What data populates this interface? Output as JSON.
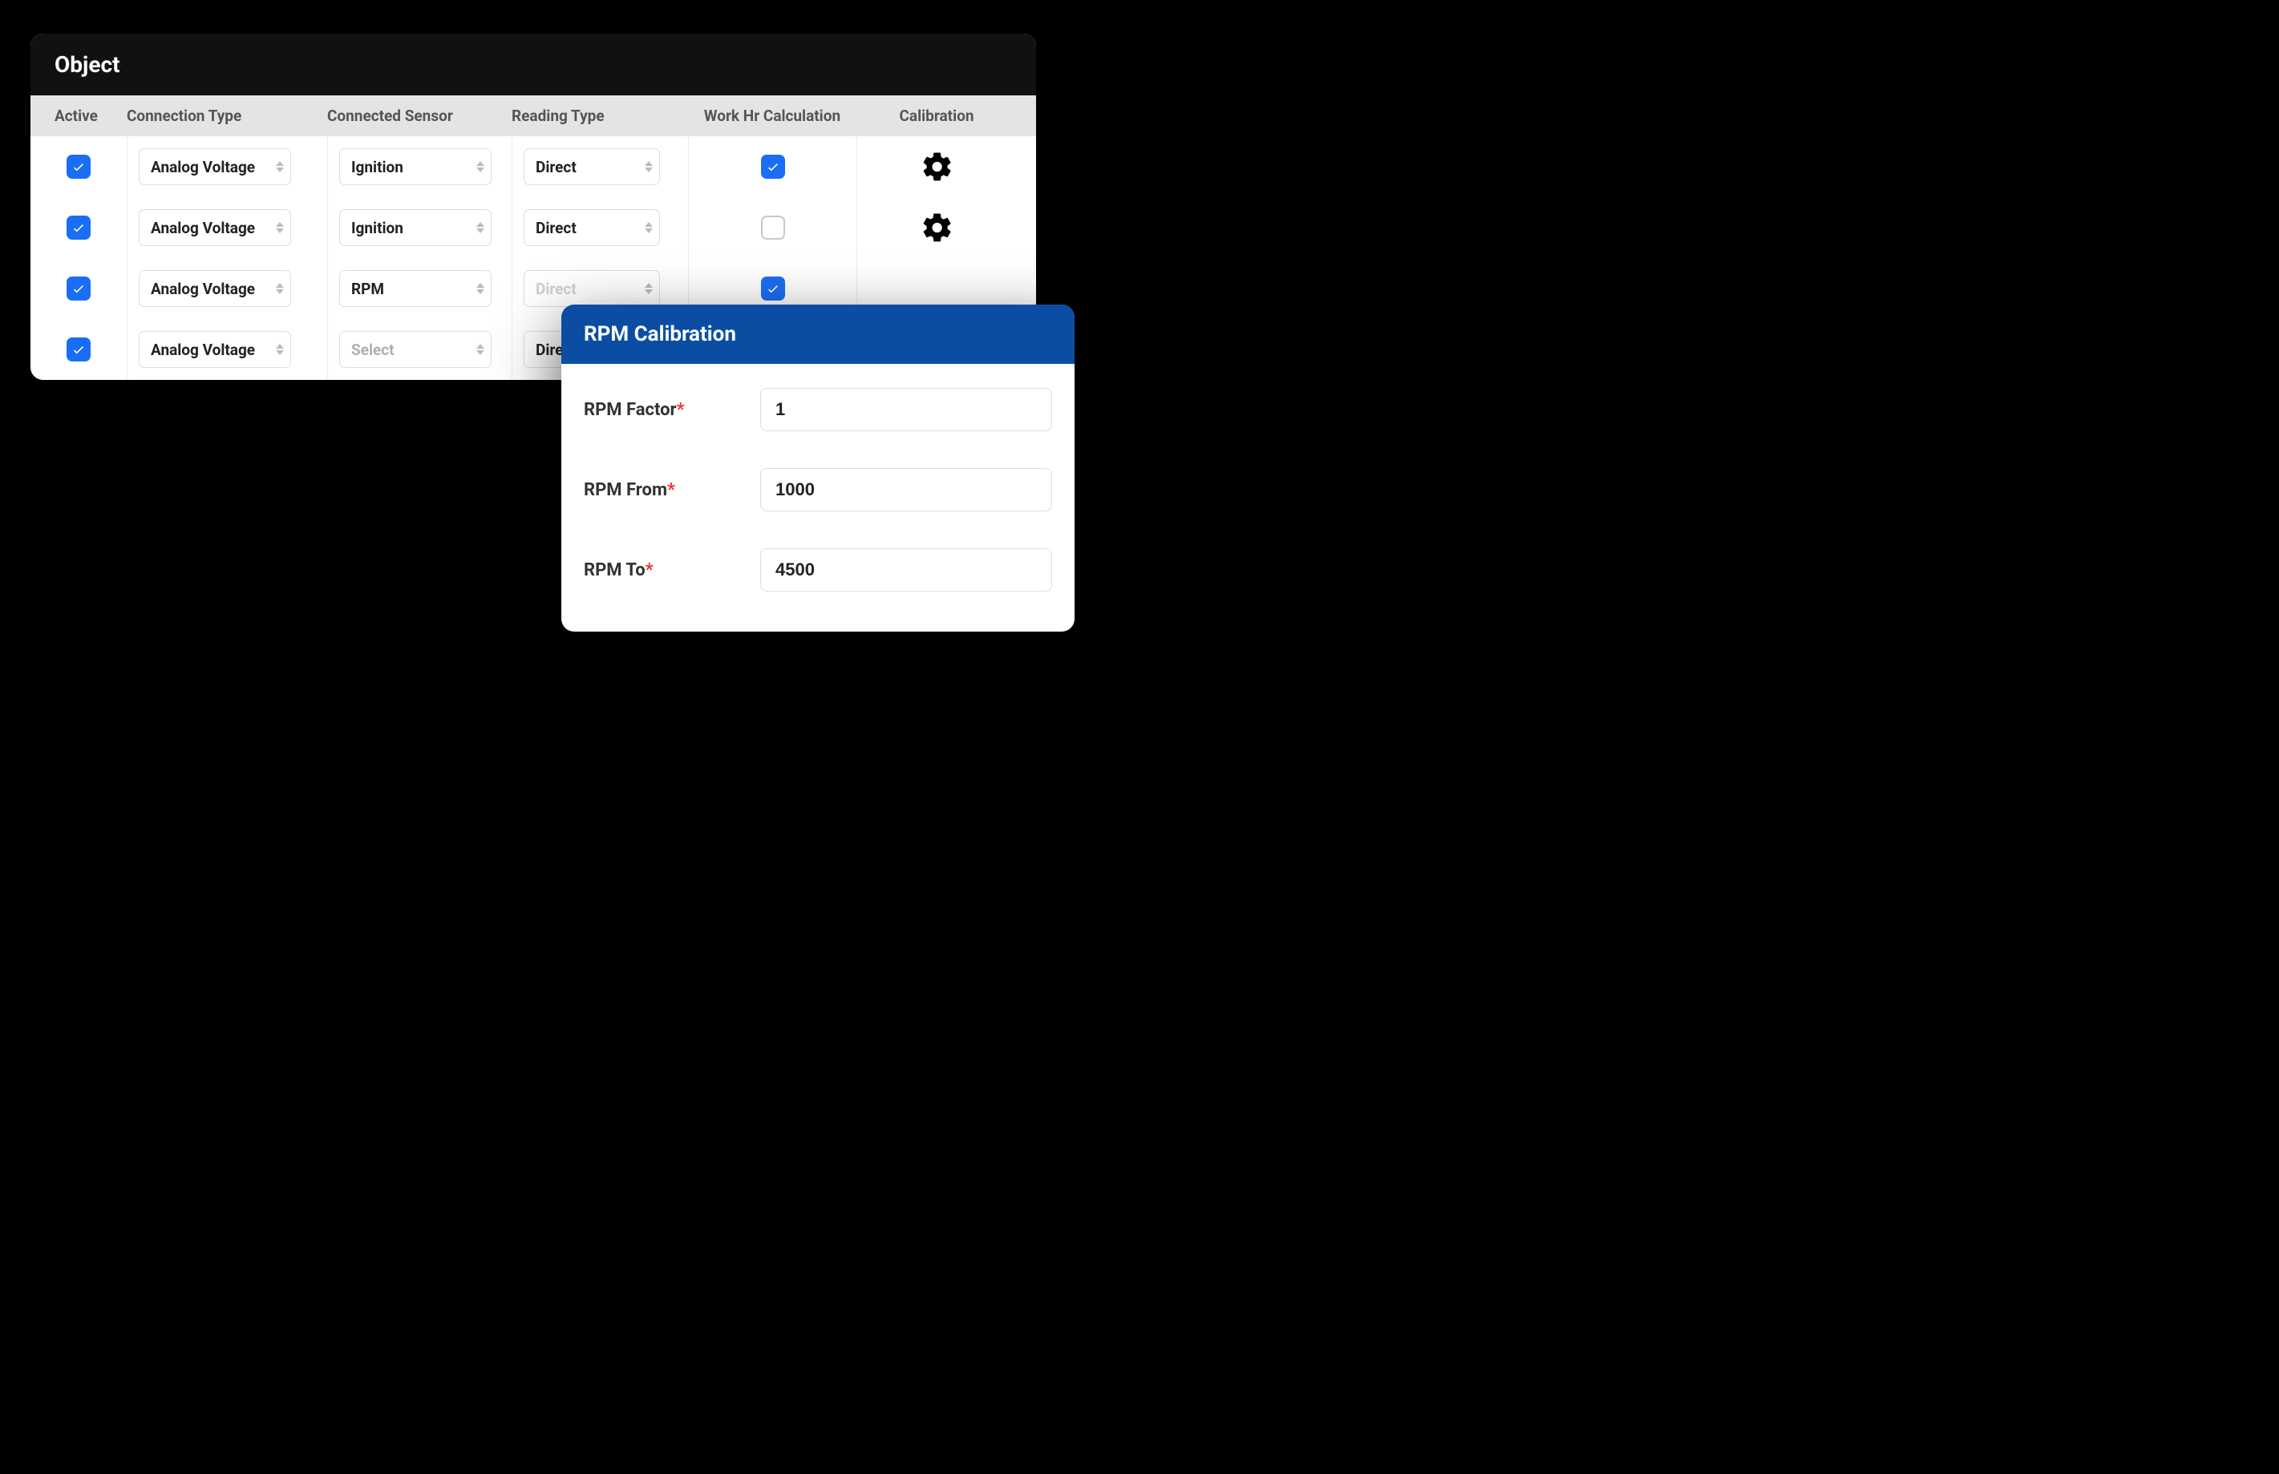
{
  "panel": {
    "title": "Object"
  },
  "columns": {
    "active": "Active",
    "connection_type": "Connection Type",
    "connected_sensor": "Connected Sensor",
    "reading_type": "Reading Type",
    "work_hr_calc": "Work Hr Calculation",
    "calibration": "Calibration"
  },
  "rows": [
    {
      "active": true,
      "connection_type": "Analog Voltage",
      "connected_sensor": "Ignition",
      "reading_type": "Direct",
      "work_hr_calc": true,
      "has_calibration": true
    },
    {
      "active": true,
      "connection_type": "Analog Voltage",
      "connected_sensor": "Ignition",
      "reading_type": "Direct",
      "work_hr_calc": false,
      "has_calibration": true
    },
    {
      "active": true,
      "connection_type": "Analog Voltage",
      "connected_sensor": "RPM",
      "reading_type": "Direct",
      "reading_type_disabled": true,
      "work_hr_calc": true,
      "has_calibration": false
    },
    {
      "active": true,
      "connection_type": "Analog Voltage",
      "connected_sensor": "Select",
      "connected_sensor_placeholder": true,
      "reading_type": "Direct",
      "work_hr_calc": null,
      "has_calibration": false
    }
  ],
  "calibration_popup": {
    "title": "RPM Calibration",
    "fields": {
      "rpm_factor_label": "RPM Factor",
      "rpm_factor_value": "1",
      "rpm_from_label": "RPM From",
      "rpm_from_value": "1000",
      "rpm_to_label": "RPM To",
      "rpm_to_value": "4500"
    }
  }
}
